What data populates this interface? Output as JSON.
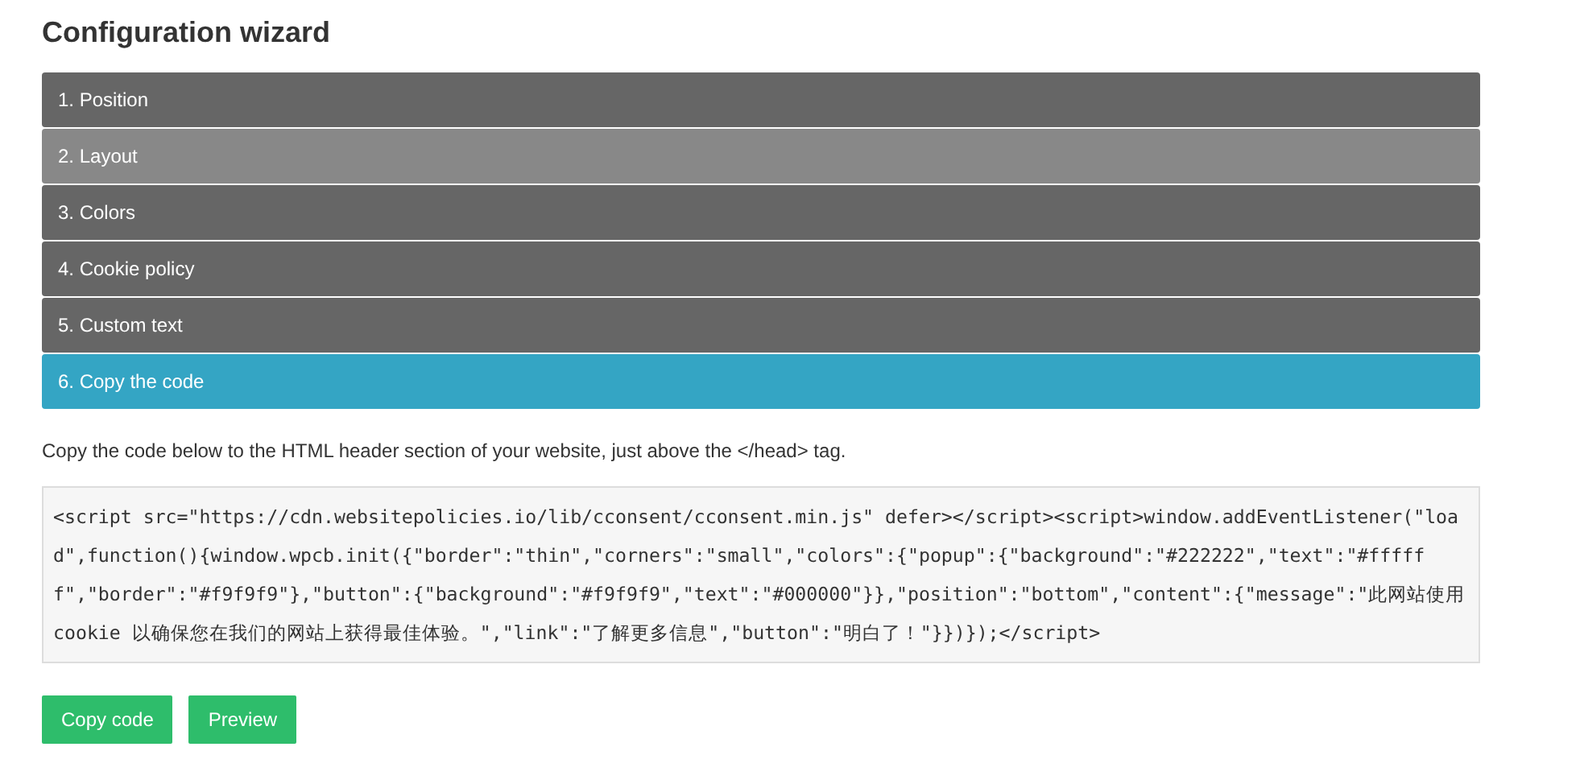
{
  "title": "Configuration wizard",
  "steps": [
    {
      "label": "1. Position",
      "selected": false,
      "hovered": false
    },
    {
      "label": "2. Layout",
      "selected": false,
      "hovered": true
    },
    {
      "label": "3. Colors",
      "selected": false,
      "hovered": false
    },
    {
      "label": "4. Cookie policy",
      "selected": false,
      "hovered": false
    },
    {
      "label": "5. Custom text",
      "selected": false,
      "hovered": false
    },
    {
      "label": "6. Copy the code",
      "selected": true,
      "hovered": false
    }
  ],
  "instruction": "Copy the code below to the HTML header section of your website, just above the </head> tag.",
  "code": "<script src=\"https://cdn.websitepolicies.io/lib/cconsent/cconsent.min.js\" defer></script><script>window.addEventListener(\"load\",function(){window.wpcb.init({\"border\":\"thin\",\"corners\":\"small\",\"colors\":{\"popup\":{\"background\":\"#222222\",\"text\":\"#ffffff\",\"border\":\"#f9f9f9\"},\"button\":{\"background\":\"#f9f9f9\",\"text\":\"#000000\"}},\"position\":\"bottom\",\"content\":{\"message\":\"此网站使用 cookie 以确保您在我们的网站上获得最佳体验。\",\"link\":\"了解更多信息\",\"button\":\"明白了！\"}})});</script>",
  "buttons": [
    "Copy code",
    "Preview"
  ]
}
